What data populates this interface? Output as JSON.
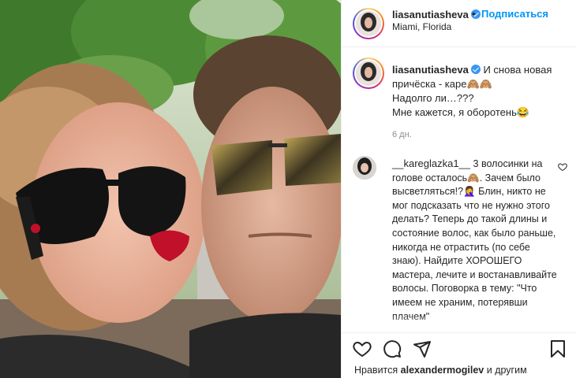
{
  "post": {
    "author": "liasanutiasheva",
    "location": "Miami, Florida",
    "dot": "•",
    "follow_label": "Подписаться",
    "caption_text": "И снова новая причёска - каре🙈🙈\nНадолго ли…???\nМне кажется, я оборотень😂",
    "time": "6 дн."
  },
  "comment": {
    "author": "__kareglazka1__",
    "text": "3 волосинки на голове осталось🙈. Зачем было высветляться!?🤦‍♀️ Блин, никто не мог подсказать что не нужно этого делать? Теперь до такой длины и состояние волос, как было раньше, никогда не отрастить (по себе знаю). Найдите ХОРОШЕГО мастера, лечите и востанавливайте волосы. Поговорка в тему: \"Что имеем не храним, потерявши плачем\""
  },
  "likes": {
    "prefix": "Нравится",
    "user": "alexandermogilev",
    "suffix": "и другим"
  },
  "icons": [
    "verified-badge-icon",
    "heart-icon",
    "comment-icon",
    "share-icon",
    "bookmark-icon",
    "like-comment-icon"
  ],
  "colors": {
    "link": "#0095f6",
    "verified": "#3897f0",
    "lips": "#c0102a"
  }
}
